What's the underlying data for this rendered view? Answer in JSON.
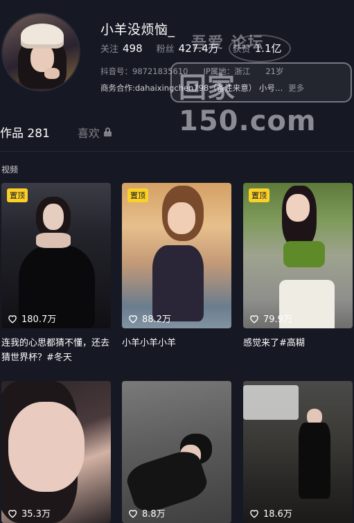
{
  "profile": {
    "nickname": "小羊没烦恼_",
    "following_label": "关注",
    "following_value": "498",
    "followers_label": "粉丝",
    "followers_value": "427.4万",
    "likes_label": "获赞",
    "likes_value": "1.1亿",
    "douyin_id": "抖音号：98721835610",
    "ip_location": "IP属地：浙江",
    "age": "21岁",
    "bio": "商务合作:dahaixingchen798（备注来意） 小号…",
    "bio_more": "更多"
  },
  "watermark": {
    "top": "吾爱 论坛",
    "main": "回家150.com"
  },
  "tabs": {
    "works": "作品 281",
    "liked": "喜欢"
  },
  "section_label": "视频",
  "pin_label": "置顶",
  "videos": [
    {
      "likes": "180.7万",
      "caption": "连我的心思都猜不懂，还去猜世界杯？#冬天",
      "pinned": true
    },
    {
      "likes": "88.2万",
      "caption": "小羊小羊小羊",
      "pinned": true
    },
    {
      "likes": "79.9万",
      "caption": "感觉来了#高糊",
      "pinned": true
    },
    {
      "likes": "35.3万",
      "caption": "",
      "pinned": false
    },
    {
      "likes": "8.8万",
      "caption": "",
      "pinned": false
    },
    {
      "likes": "18.6万",
      "caption": "",
      "pinned": false
    }
  ],
  "colors": {
    "background": "#161823",
    "pin": "#fbd027"
  }
}
